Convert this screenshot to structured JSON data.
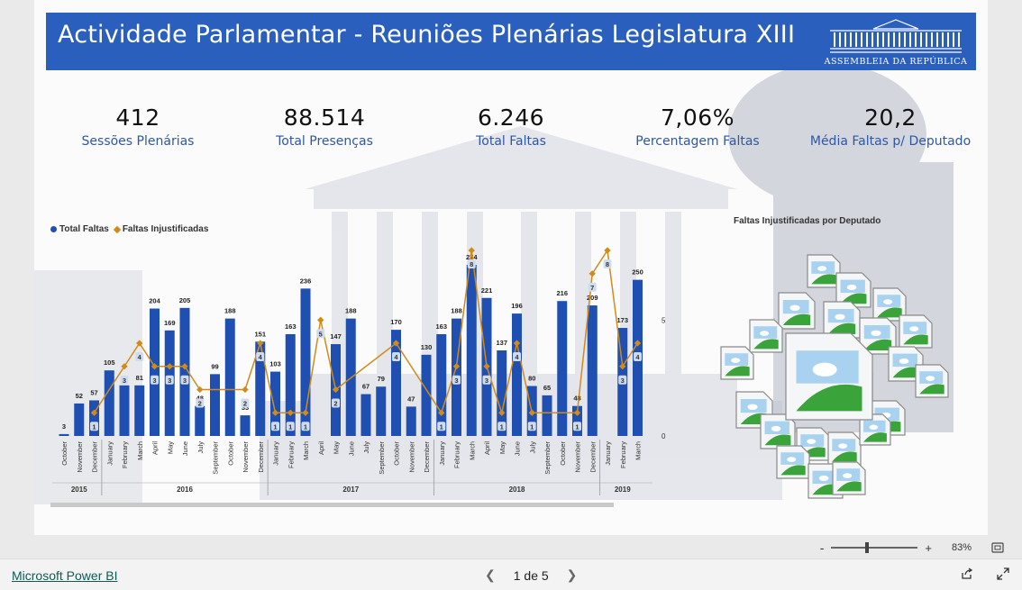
{
  "report": {
    "title": "Actividade Parlamentar - Reuniões Plenárias Legislatura XIII",
    "logo_text": "Assembleia da República"
  },
  "kpis": [
    {
      "value": "412",
      "label": "Sessões Plenárias"
    },
    {
      "value": "88.514",
      "label": "Total Presenças"
    },
    {
      "value": "6.246",
      "label": "Total Faltas"
    },
    {
      "value": "7,06%",
      "label": "Percentagem Faltas"
    },
    {
      "value": "20,2",
      "label": "Média Faltas p/ Deputado"
    }
  ],
  "legend": {
    "series1": "Total Faltas",
    "series2": "Faltas Injustificadas"
  },
  "chart_data": {
    "type": "bar",
    "series": [
      {
        "name": "Total Faltas",
        "values": [
          3,
          52,
          57,
          105,
          81,
          81,
          204,
          169,
          205,
          48,
          99,
          188,
          33,
          151,
          103,
          163,
          236,
          null,
          147,
          188,
          67,
          79,
          170,
          47,
          130,
          163,
          188,
          274,
          221,
          137,
          196,
          80,
          65,
          216,
          48,
          209,
          null,
          173,
          250
        ]
      },
      {
        "name": "Faltas Injustificadas",
        "values": [
          null,
          null,
          1,
          null,
          3,
          4,
          3,
          3,
          3,
          2,
          null,
          null,
          2,
          4,
          1,
          1,
          1,
          5,
          2,
          null,
          null,
          null,
          4,
          null,
          null,
          1,
          3,
          8,
          3,
          1,
          4,
          1,
          null,
          null,
          1,
          7,
          8,
          3,
          4
        ]
      }
    ],
    "categories": [
      "October",
      "November",
      "December",
      "January",
      "February",
      "March",
      "April",
      "May",
      "June",
      "July",
      "September",
      "October",
      "November",
      "December",
      "January",
      "February",
      "March",
      "April",
      "May",
      "June",
      "July",
      "September",
      "October",
      "November",
      "December",
      "January",
      "February",
      "March",
      "April",
      "May",
      "June",
      "July",
      "September",
      "October",
      "November",
      "December",
      "January",
      "February",
      "March"
    ],
    "years": [
      {
        "label": "2015",
        "start": 0,
        "count": 3
      },
      {
        "label": "2016",
        "start": 3,
        "count": 11
      },
      {
        "label": "2017",
        "start": 14,
        "count": 11
      },
      {
        "label": "2018",
        "start": 25,
        "count": 11
      },
      {
        "label": "2019",
        "start": 36,
        "count": 3
      }
    ],
    "bar_color": "#1f4fb0",
    "line_color": "#d08b18",
    "right_axis_ticks": [
      "5",
      "0"
    ]
  },
  "right_visual": {
    "title": "Faltas Injustificadas por Deputado"
  },
  "zoom": {
    "minus": "-",
    "plus": "+",
    "level": "83%"
  },
  "footer": {
    "brand": "Microsoft Power BI",
    "page": "1 de 5"
  }
}
